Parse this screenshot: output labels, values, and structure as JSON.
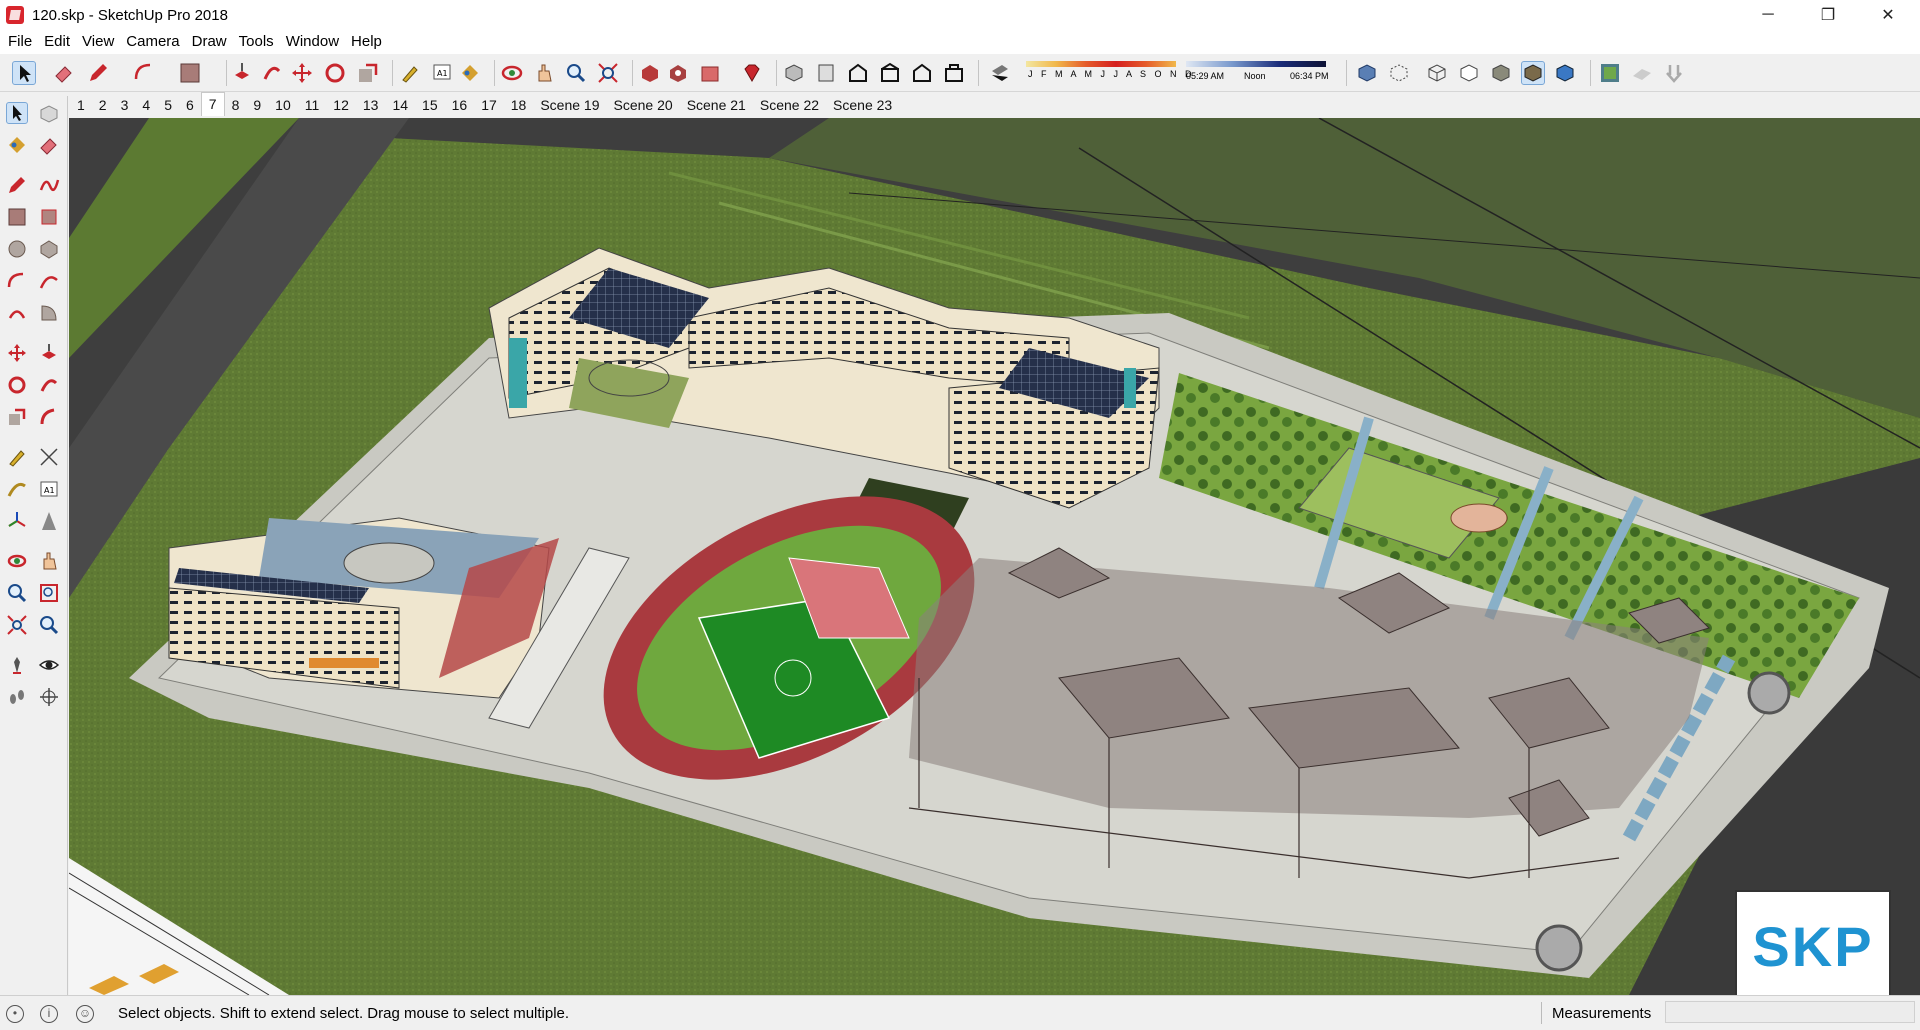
{
  "window": {
    "title": "120.skp - SketchUp Pro 2018",
    "minimize": "─",
    "maximize": "❐",
    "close": "✕"
  },
  "menu": [
    "File",
    "Edit",
    "View",
    "Camera",
    "Draw",
    "Tools",
    "Window",
    "Help"
  ],
  "shadow_settings": {
    "months": "J F M A M J J A S O N D",
    "time_start": "05:29 AM",
    "time_noon": "Noon",
    "time_end": "06:34 PM"
  },
  "scenes": {
    "tabs": [
      "1",
      "2",
      "3",
      "4",
      "5",
      "6",
      "7",
      "8",
      "9",
      "10",
      "11",
      "12",
      "13",
      "14",
      "15",
      "16",
      "17",
      "18",
      "Scene 19",
      "Scene 20",
      "Scene 21",
      "Scene 22",
      "Scene 23"
    ],
    "active_index": 6
  },
  "status": {
    "message": "Select objects. Shift to extend select. Drag mouse to select multiple.",
    "measurements_label": "Measurements",
    "measurements_value": ""
  },
  "watermark": "SKP",
  "icons": {
    "select": "arrow-icon",
    "eraser": "eraser-icon",
    "pencil": "pencil-icon",
    "arc": "arc-icon",
    "rectangle": "rectangle-icon",
    "push_pull": "push-pull-icon",
    "move": "move-icon",
    "rotate": "rotate-icon",
    "scale": "scale-icon",
    "tape": "tape-measure-icon",
    "text": "text-icon",
    "paint": "paint-bucket-icon",
    "orbit": "orbit-icon",
    "pan": "pan-icon",
    "zoom": "zoom-icon",
    "zoom_extents": "zoom-extents-icon"
  },
  "colors": {
    "accent": "#1f93d1",
    "brand_red": "#d8262d",
    "lawn": "#5a7a2c",
    "road": "#3c3c3c",
    "track": "#a4353a",
    "field": "#1e8a24"
  }
}
